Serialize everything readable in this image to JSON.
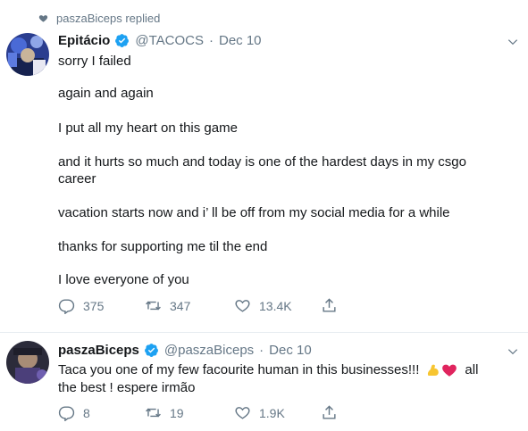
{
  "context": {
    "text": "paszaBiceps replied"
  },
  "tweets": [
    {
      "display_name": "Epitácio",
      "handle": "@TACOCS",
      "separator": "·",
      "date": "Dec 10",
      "lines": [
        "sorry I failed",
        "again and again",
        "I put all my heart on this game",
        "and it hurts so much and today is one of the hardest days in my csgo",
        "career",
        "vacation starts now and i’  ll be off from my social media for a while",
        "thanks for supporting me til the end",
        "I love everyone of you"
      ],
      "replies": "375",
      "retweets": "347",
      "likes": "13.4K"
    },
    {
      "display_name": "paszaBiceps",
      "handle": "@paszaBiceps",
      "separator": "·",
      "date": "Dec 10",
      "lines": [
        "Taca you one of my few facourite human in this businesses!!!",
        "all",
        "the best ! espere irmão"
      ],
      "replies": "8",
      "retweets": "19",
      "likes": "1.9K"
    }
  ],
  "icons": {
    "context": "heart-icon",
    "verified": "verified-badge-icon",
    "menu": "chevron-down-icon",
    "reply": "reply-icon",
    "retweet": "retweet-icon",
    "like": "like-icon",
    "share": "share-icon",
    "emoji": [
      "flexed-biceps-emoji",
      "red-heart-emoji"
    ]
  },
  "colors": {
    "verified": "#1da1f2",
    "muted": "#657786",
    "text": "#14171a",
    "divider": "#e6ecf0"
  }
}
